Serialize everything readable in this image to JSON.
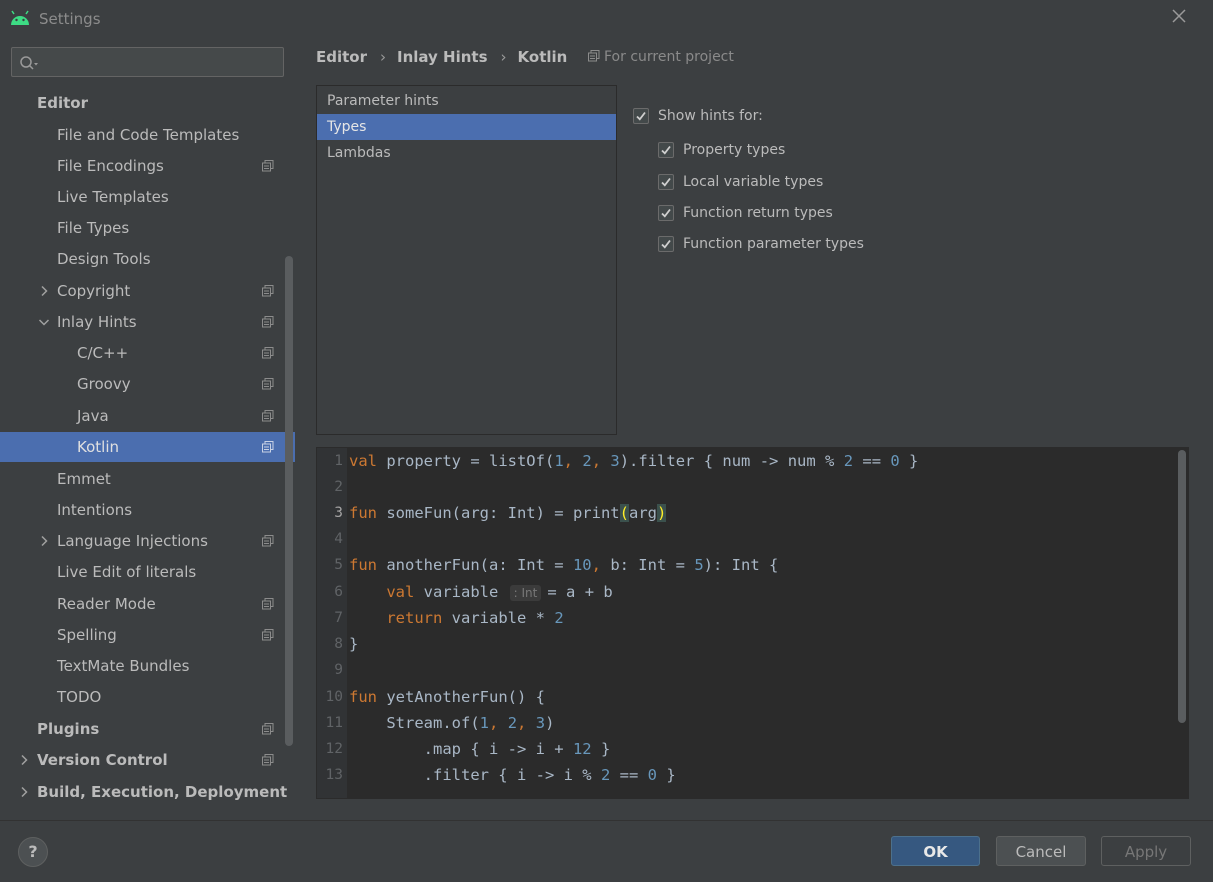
{
  "window": {
    "title": "Settings"
  },
  "search": {
    "placeholder": "",
    "value": ""
  },
  "sidebar": {
    "items": [
      {
        "label": "Editor"
      },
      {
        "label": "File and Code Templates"
      },
      {
        "label": "File Encodings"
      },
      {
        "label": "Live Templates"
      },
      {
        "label": "File Types"
      },
      {
        "label": "Design Tools"
      },
      {
        "label": "Copyright"
      },
      {
        "label": "Inlay Hints"
      },
      {
        "label": "C/C++"
      },
      {
        "label": "Groovy"
      },
      {
        "label": "Java"
      },
      {
        "label": "Kotlin"
      },
      {
        "label": "Emmet"
      },
      {
        "label": "Intentions"
      },
      {
        "label": "Language Injections"
      },
      {
        "label": "Live Edit of literals"
      },
      {
        "label": "Reader Mode"
      },
      {
        "label": "Spelling"
      },
      {
        "label": "TextMate Bundles"
      },
      {
        "label": "TODO"
      },
      {
        "label": "Plugins"
      },
      {
        "label": "Version Control"
      },
      {
        "label": "Build, Execution, Deployment"
      }
    ],
    "selected": "Kotlin"
  },
  "breadcrumb": {
    "items": [
      "Editor",
      "Inlay Hints",
      "Kotlin"
    ],
    "scope": "For current project"
  },
  "hint_types": {
    "items": [
      "Parameter hints",
      "Types",
      "Lambdas"
    ],
    "selected": "Types"
  },
  "options": {
    "show_hints_label": "Show hints for:",
    "show_hints_checked": true,
    "items": [
      {
        "label": "Property types",
        "checked": true
      },
      {
        "label": "Local variable types",
        "checked": true
      },
      {
        "label": "Function return types",
        "checked": true
      },
      {
        "label": "Function parameter types",
        "checked": true
      }
    ]
  },
  "preview": {
    "line_numbers": [
      "1",
      "2",
      "3",
      "4",
      "5",
      "6",
      "7",
      "8",
      "9",
      "10",
      "11",
      "12",
      "13"
    ],
    "current_line": 3,
    "lines": [
      "val property = listOf(1, 2, 3).filter { num -> num % 2 == 0 }",
      "",
      "fun someFun(arg: Int) = print(arg)",
      "",
      "fun anotherFun(a: Int = 10, b: Int = 5): Int {",
      "    val variable : Int = a + b",
      "    return variable * 2",
      "}",
      "",
      "fun yetAnotherFun() {",
      "    Stream.of(1, 2, 3)",
      "        .map { i -> i + 12 }",
      "        .filter { i -> i % 2 == 0 }"
    ],
    "inlay_hint": ": Int"
  },
  "buttons": {
    "help": "?",
    "ok": "OK",
    "cancel": "Cancel",
    "apply": "Apply"
  },
  "colors": {
    "accent": "#4b6eaf",
    "background": "#3c3f41",
    "editor_bg": "#2b2b2b",
    "keyword": "#cc7832",
    "number": "#6897bb"
  }
}
